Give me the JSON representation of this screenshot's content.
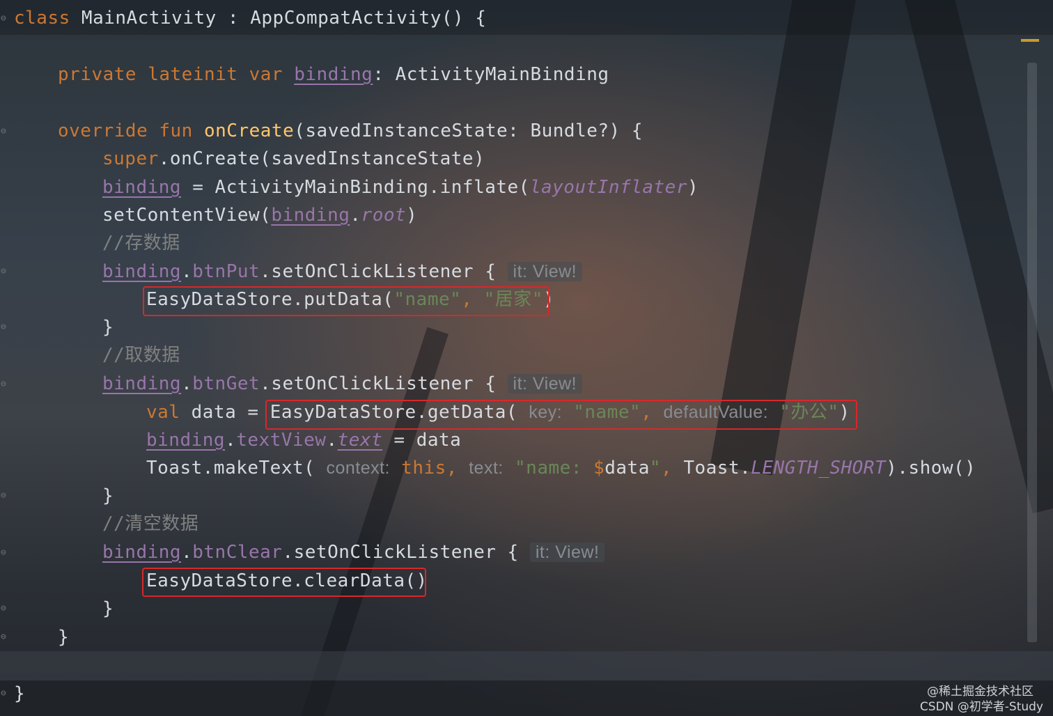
{
  "editor": {
    "lines": {
      "l1": {
        "kw": "class",
        "name": " MainActivity : AppCompatActivity() {"
      },
      "l2": {
        "kw": "private lateinit var ",
        "prop": "binding",
        "rest": ": ActivityMainBinding"
      },
      "l3": {
        "kw": "override fun ",
        "fn": "onCreate",
        "rest": "(savedInstanceState: Bundle?) {"
      },
      "l4": {
        "kw": "super",
        "rest": ".onCreate(savedInstanceState)"
      },
      "l5": {
        "prop": "binding",
        "mid": " = ActivityMainBinding.inflate(",
        "ital": "layoutInflater",
        "end": ")"
      },
      "l6": {
        "pre": "setContentView(",
        "prop": "binding",
        "dot": ".",
        "ital": "root",
        "end": ")"
      },
      "l7": {
        "comment": "//存数据"
      },
      "l8": {
        "prop": "binding",
        "dot": ".",
        "prop2": "btnPut",
        "rest": ".setOnClickListener { ",
        "hint": "it: View!"
      },
      "l9": {
        "pre": "EasyDataStore.putData(",
        "s1": "\"name\"",
        "comma": ", ",
        "s2": "\"居家\"",
        "end": ")"
      },
      "l10": {
        "text": "}"
      },
      "l11": {
        "comment": "//取数据"
      },
      "l12": {
        "prop": "binding",
        "dot": ".",
        "prop2": "btnGet",
        "rest": ".setOnClickListener { ",
        "hint": "it: View!"
      },
      "l13": {
        "kw": "val",
        "mid": " data = ",
        "pre": "EasyDataStore.getData( ",
        "hint1": "key:",
        "s1": " \"name\"",
        "comma": ", ",
        "hint2": "defaultValue:",
        "s2": " \"办公\"",
        "end": ")"
      },
      "l14": {
        "prop": "binding",
        "dot": ".",
        "prop2": "textView",
        "dot2": ".",
        "ital": "text",
        "rest": " = data"
      },
      "l15": {
        "pre": "Toast.makeText( ",
        "hint1": "context:",
        "kw": " this",
        "comma": ", ",
        "hint2": "text:",
        "s1": " \"name: ",
        "kw2": "$",
        "tmpl": "data",
        "s2": "\"",
        "comma2": ", ",
        "mid": "Toast.",
        "ital": "LENGTH_SHORT",
        "end": ").show()"
      },
      "l16": {
        "text": "}"
      },
      "l17": {
        "comment": "//清空数据"
      },
      "l18": {
        "prop": "binding",
        "dot": ".",
        "prop2": "btnClear",
        "rest": ".setOnClickListener { ",
        "hint": "it: View!"
      },
      "l19": {
        "pre": "EasyDataStore.clearData()"
      },
      "l20": {
        "text": "}"
      },
      "l21": {
        "text": "}"
      },
      "l22": {
        "text": "}"
      }
    }
  },
  "watermark": {
    "line1": "@稀土掘金技术社区",
    "line2": "CSDN @初学者-Study"
  },
  "colors": {
    "keyword": "#cc7832",
    "function": "#ffc66d",
    "property": "#9876aa",
    "string": "#6a8759",
    "comment": "#808080",
    "highlight_box": "#d8282a"
  }
}
